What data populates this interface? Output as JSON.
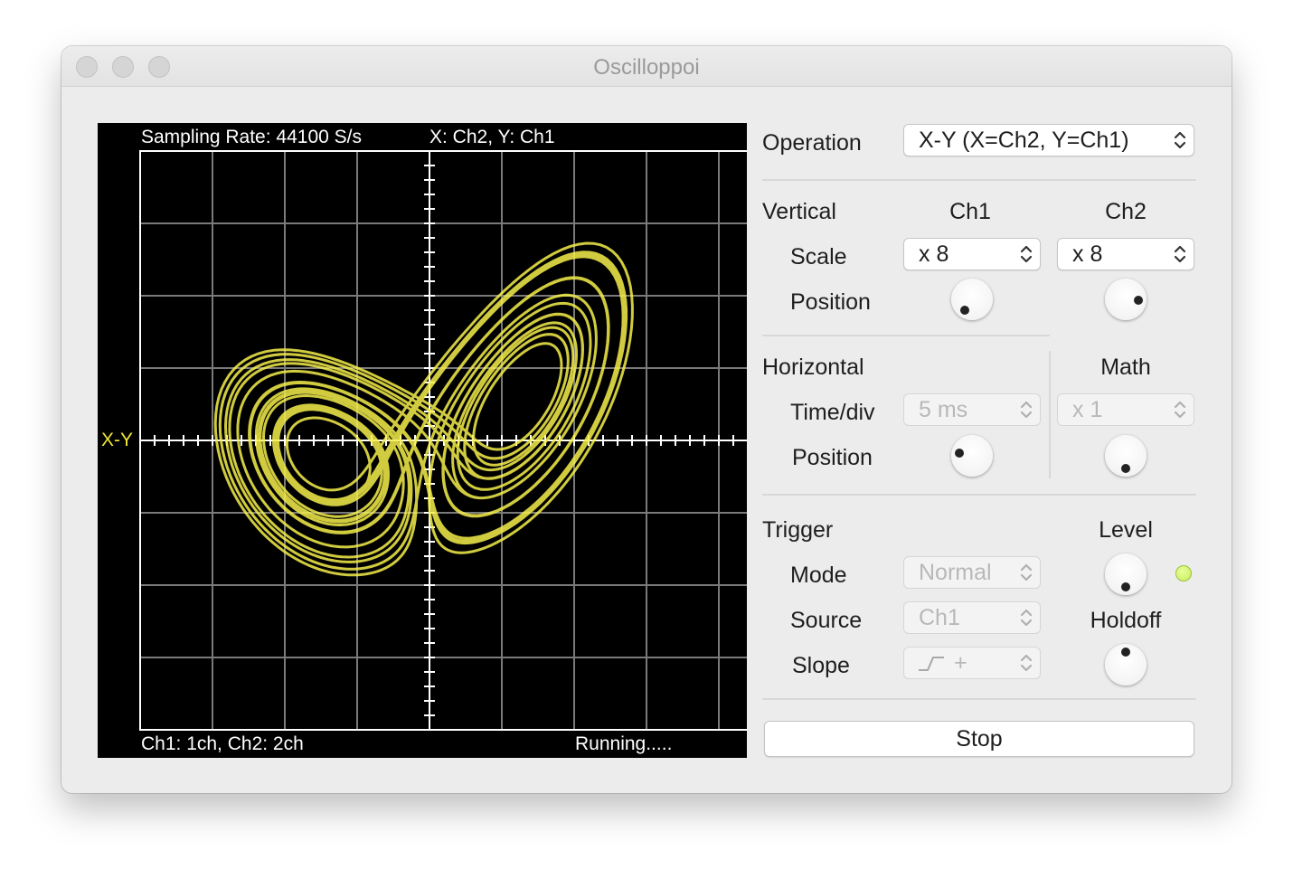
{
  "window": {
    "title": "Oscilloppoi"
  },
  "scope": {
    "sampling_rate": "Sampling Rate: 44100 S/s",
    "axes_assignment": "X: Ch2,  Y: Ch1",
    "mode_marker": "X-Y",
    "channel_info": "Ch1: 1ch, Ch2: 2ch",
    "status": "Running.....",
    "trace_color": "#f5ee4a",
    "grid_color": "#7a7a7a"
  },
  "controls": {
    "operation": {
      "label": "Operation",
      "value": "X-Y (X=Ch2, Y=Ch1)"
    },
    "vertical": {
      "label": "Vertical",
      "ch1_header": "Ch1",
      "ch2_header": "Ch2",
      "scale_label": "Scale",
      "ch1_scale": "x 8",
      "ch2_scale": "x 8",
      "position_label": "Position"
    },
    "horizontal": {
      "label": "Horizontal",
      "timediv_label": "Time/div",
      "timediv_value": "5 ms",
      "position_label": "Position"
    },
    "math": {
      "label": "Math",
      "value": "x 1"
    },
    "trigger": {
      "label": "Trigger",
      "mode_label": "Mode",
      "mode_value": "Normal",
      "source_label": "Source",
      "source_value": "Ch1",
      "slope_label": "Slope",
      "slope_value": "+",
      "level_label": "Level",
      "holdoff_label": "Holdoff",
      "led_color": "#c8ef60"
    },
    "stop_button": "Stop"
  },
  "icons": {
    "knob": "rotary-knob-icon",
    "popup_arrows": "up-down-chevrons-icon",
    "slope": "rising-edge-icon"
  }
}
